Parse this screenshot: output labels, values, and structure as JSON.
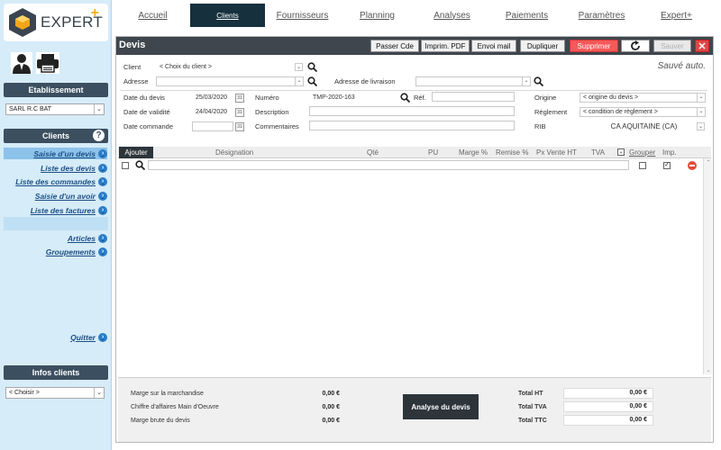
{
  "app": {
    "brand": "EXPERT",
    "brand_plus": "+"
  },
  "sidebar": {
    "etablissement_title": "Etablissement",
    "etablissement_value": "SARL R.C BAT",
    "clients_title": "Clients",
    "help_glyph": "?",
    "nav": [
      {
        "label": "Saisie d'un devis"
      },
      {
        "label": "Liste des devis"
      },
      {
        "label": "Liste des commandes"
      },
      {
        "label": "Saisie d'un avoir"
      },
      {
        "label": "Liste des factures"
      },
      {
        "label": "Articles"
      },
      {
        "label": "Groupements"
      },
      {
        "label": "Quitter"
      }
    ],
    "infos_title": "Infos clients",
    "infos_value": "< Choisir >"
  },
  "tabs": [
    {
      "label": "Accueil"
    },
    {
      "label": "Clients"
    },
    {
      "label": "Fournisseurs"
    },
    {
      "label": "Planning"
    },
    {
      "label": "Analyses"
    },
    {
      "label": "Paiements"
    },
    {
      "label": "Paramètres"
    },
    {
      "label": "Expert+"
    }
  ],
  "panel": {
    "title": "Devis",
    "buttons": {
      "passer_cde": "Passer Cde",
      "imprim_pdf": "Imprim. PDF",
      "envoi_mail": "Envoi mail",
      "dupliquer": "Dupliquer",
      "supprimer": "Supprimer",
      "sauver": "Sauver",
      "close": "✕"
    },
    "autosave": "Sauvé auto."
  },
  "form": {
    "client_label": "Client",
    "client_value": "< Choix du client >",
    "adresse_label": "Adresse",
    "adresse_livraison_label": "Adresse de livraison",
    "date_devis_label": "Date du devis",
    "date_devis_value": "25/03/2020",
    "date_validite_label": "Date de validité",
    "date_validite_value": "24/04/2020",
    "date_commande_label": "Date commande",
    "numero_label": "Numéro",
    "numero_value": "TMP-2020-163",
    "ref_label": "Réf.",
    "description_label": "Description",
    "commentaires_label": "Commentaires",
    "origine_label": "Origine",
    "origine_value": "< origine du devis >",
    "reglement_label": "Règlement",
    "reglement_value": "< condition de règlement >",
    "rib_label": "RIB",
    "rib_value": "CA AQUITAINE (CA)",
    "cal_glyph": "31"
  },
  "table": {
    "add_label": "Ajouter",
    "headers": {
      "designation": "Désignation",
      "qte": "Qté",
      "pu": "PU",
      "marge": "Marge %",
      "remise": "Remise %",
      "px_vente": "Px Vente HT",
      "tva": "TVA",
      "grouper": "Grouper",
      "imp": "Imp."
    },
    "row": {
      "grouper_checked": false,
      "imp_checked": true,
      "imp_mark": "✓"
    }
  },
  "footer": {
    "marge_marchandise_label": "Marge sur la marchandise",
    "marge_marchandise_value": "0,00 €",
    "ca_main_oeuvre_label": "Chiffre d'affaires Main d'Oeuvre",
    "ca_main_oeuvre_value": "0,00 €",
    "marge_brute_label": "Marge brute du devis",
    "marge_brute_value": "0,00 €",
    "analyse_button": "Analyse du devis",
    "total_ht_label": "Total HT",
    "total_ht_value": "0,00 €",
    "total_tva_label": "Total TVA",
    "total_tva_value": "0,00 €",
    "total_ttc_label": "Total TTC",
    "total_ttc_value": "0,00 €"
  },
  "colors": {
    "sidebar_bg": "#d6ecf8",
    "sidebar_title": "#3c4f60",
    "active_tab": "#16303e",
    "panel_header": "#3f464d",
    "nav_link": "#1c4f86",
    "delete_red": "#f45a5a"
  }
}
